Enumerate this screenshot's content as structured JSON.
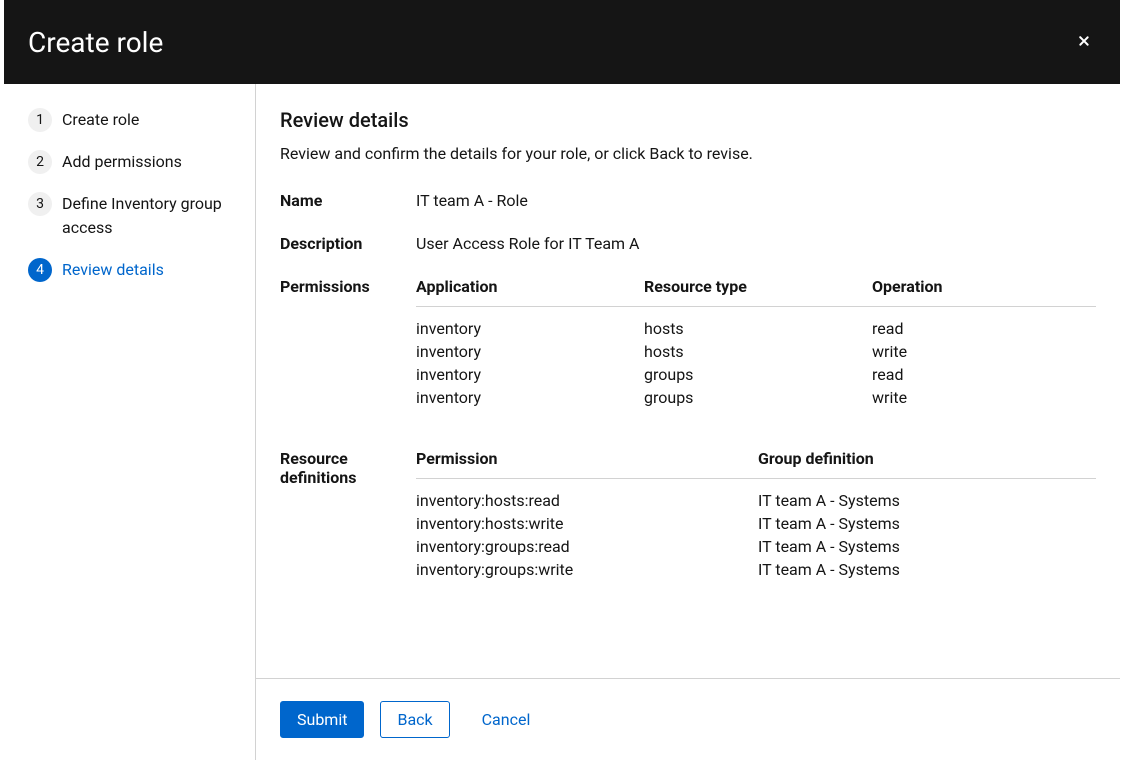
{
  "modal": {
    "title": "Create role"
  },
  "sidebar": {
    "steps": [
      {
        "number": "1",
        "label": "Create role",
        "active": false
      },
      {
        "number": "2",
        "label": "Add permissions",
        "active": false
      },
      {
        "number": "3",
        "label": "Define Inventory group access",
        "active": false
      },
      {
        "number": "4",
        "label": "Review details",
        "active": true
      }
    ]
  },
  "content": {
    "title": "Review details",
    "subtitle": "Review and confirm the details for your role, or click Back to revise.",
    "name_label": "Name",
    "name_value": "IT team A - Role",
    "description_label": "Description",
    "description_value": "User Access Role for IT Team A",
    "permissions_label": "Permissions",
    "permissions_headers": {
      "application": "Application",
      "resource_type": "Resource type",
      "operation": "Operation"
    },
    "permissions_rows": [
      {
        "application": "inventory",
        "resource_type": "hosts",
        "operation": "read"
      },
      {
        "application": "inventory",
        "resource_type": "hosts",
        "operation": "write"
      },
      {
        "application": "inventory",
        "resource_type": "groups",
        "operation": "read"
      },
      {
        "application": "inventory",
        "resource_type": "groups",
        "operation": "write"
      }
    ],
    "resdef_label": "Resource definitions",
    "resdef_headers": {
      "permission": "Permission",
      "group_definition": "Group definition"
    },
    "resdef_rows": [
      {
        "permission": "inventory:hosts:read",
        "group": "IT team A - Systems"
      },
      {
        "permission": "inventory:hosts:write",
        "group": "IT team A - Systems"
      },
      {
        "permission": "inventory:groups:read",
        "group": "IT team A - Systems"
      },
      {
        "permission": "inventory:groups:write",
        "group": "IT team A - Systems"
      }
    ]
  },
  "footer": {
    "submit": "Submit",
    "back": "Back",
    "cancel": "Cancel"
  }
}
